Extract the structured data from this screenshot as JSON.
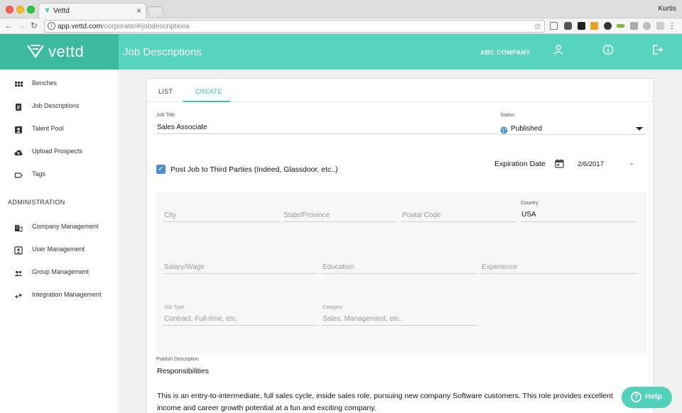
{
  "browser": {
    "tab_title": "Vettd",
    "user": "Kurtis",
    "url_host": "app.vettd.com",
    "url_path": "/corporate/#/jobdescriptions"
  },
  "brand": {
    "logo_text": "vettd",
    "accent": "#3cba9f",
    "header_color": "#56d4bd"
  },
  "header": {
    "page_title": "Job Descriptions",
    "company": "ABC COMPANY"
  },
  "sidebar": {
    "items": [
      {
        "label": "Benches",
        "icon": "grid-icon"
      },
      {
        "label": "Job Descriptions",
        "icon": "clipboard-icon"
      },
      {
        "label": "Talent Pool",
        "icon": "contact-icon"
      },
      {
        "label": "Upload Prospects",
        "icon": "cloud-upload-icon"
      },
      {
        "label": "Tags",
        "icon": "tag-icon"
      }
    ],
    "section_title": "ADMINISTRATION",
    "admin_items": [
      {
        "label": "Company Management",
        "icon": "building-icon"
      },
      {
        "label": "User Management",
        "icon": "user-box-icon"
      },
      {
        "label": "Group Management",
        "icon": "group-icon"
      },
      {
        "label": "Integration Management",
        "icon": "integration-icon"
      }
    ]
  },
  "tabs": {
    "list": "LIST",
    "create": "CREATE"
  },
  "form": {
    "job_title_label": "Job Title",
    "job_title_value": "Sales Associate",
    "status_label": "Status",
    "status_value": "Published",
    "post_third_party": "Post Job to Third Parties (Indeed, Glassdoor, etc..)",
    "expiration_label": "Expiration Date",
    "expiration_value": "2/6/2017",
    "city_placeholder": "City",
    "state_placeholder": "State/Province",
    "postal_placeholder": "Postal Code",
    "country_label": "Country",
    "country_value": "USA",
    "salary_placeholder": "Salary/Wage",
    "education_placeholder": "Education",
    "experience_placeholder": "Experience",
    "job_type_label": "Job Type",
    "job_type_placeholder": "Contract, Full-time, etc.",
    "category_label": "Category",
    "category_placeholder": "Sales, Management, etc.",
    "publish_desc_label": "Publish Description",
    "desc_heading": "Responsibilities",
    "desc_body": "This is an entry-to-intermediate, full sales cycle, inside sales role, pursuing new company Software customers. This role provides excellent income and career growth potential at a fun and exciting company."
  },
  "help": {
    "label": "Help"
  }
}
